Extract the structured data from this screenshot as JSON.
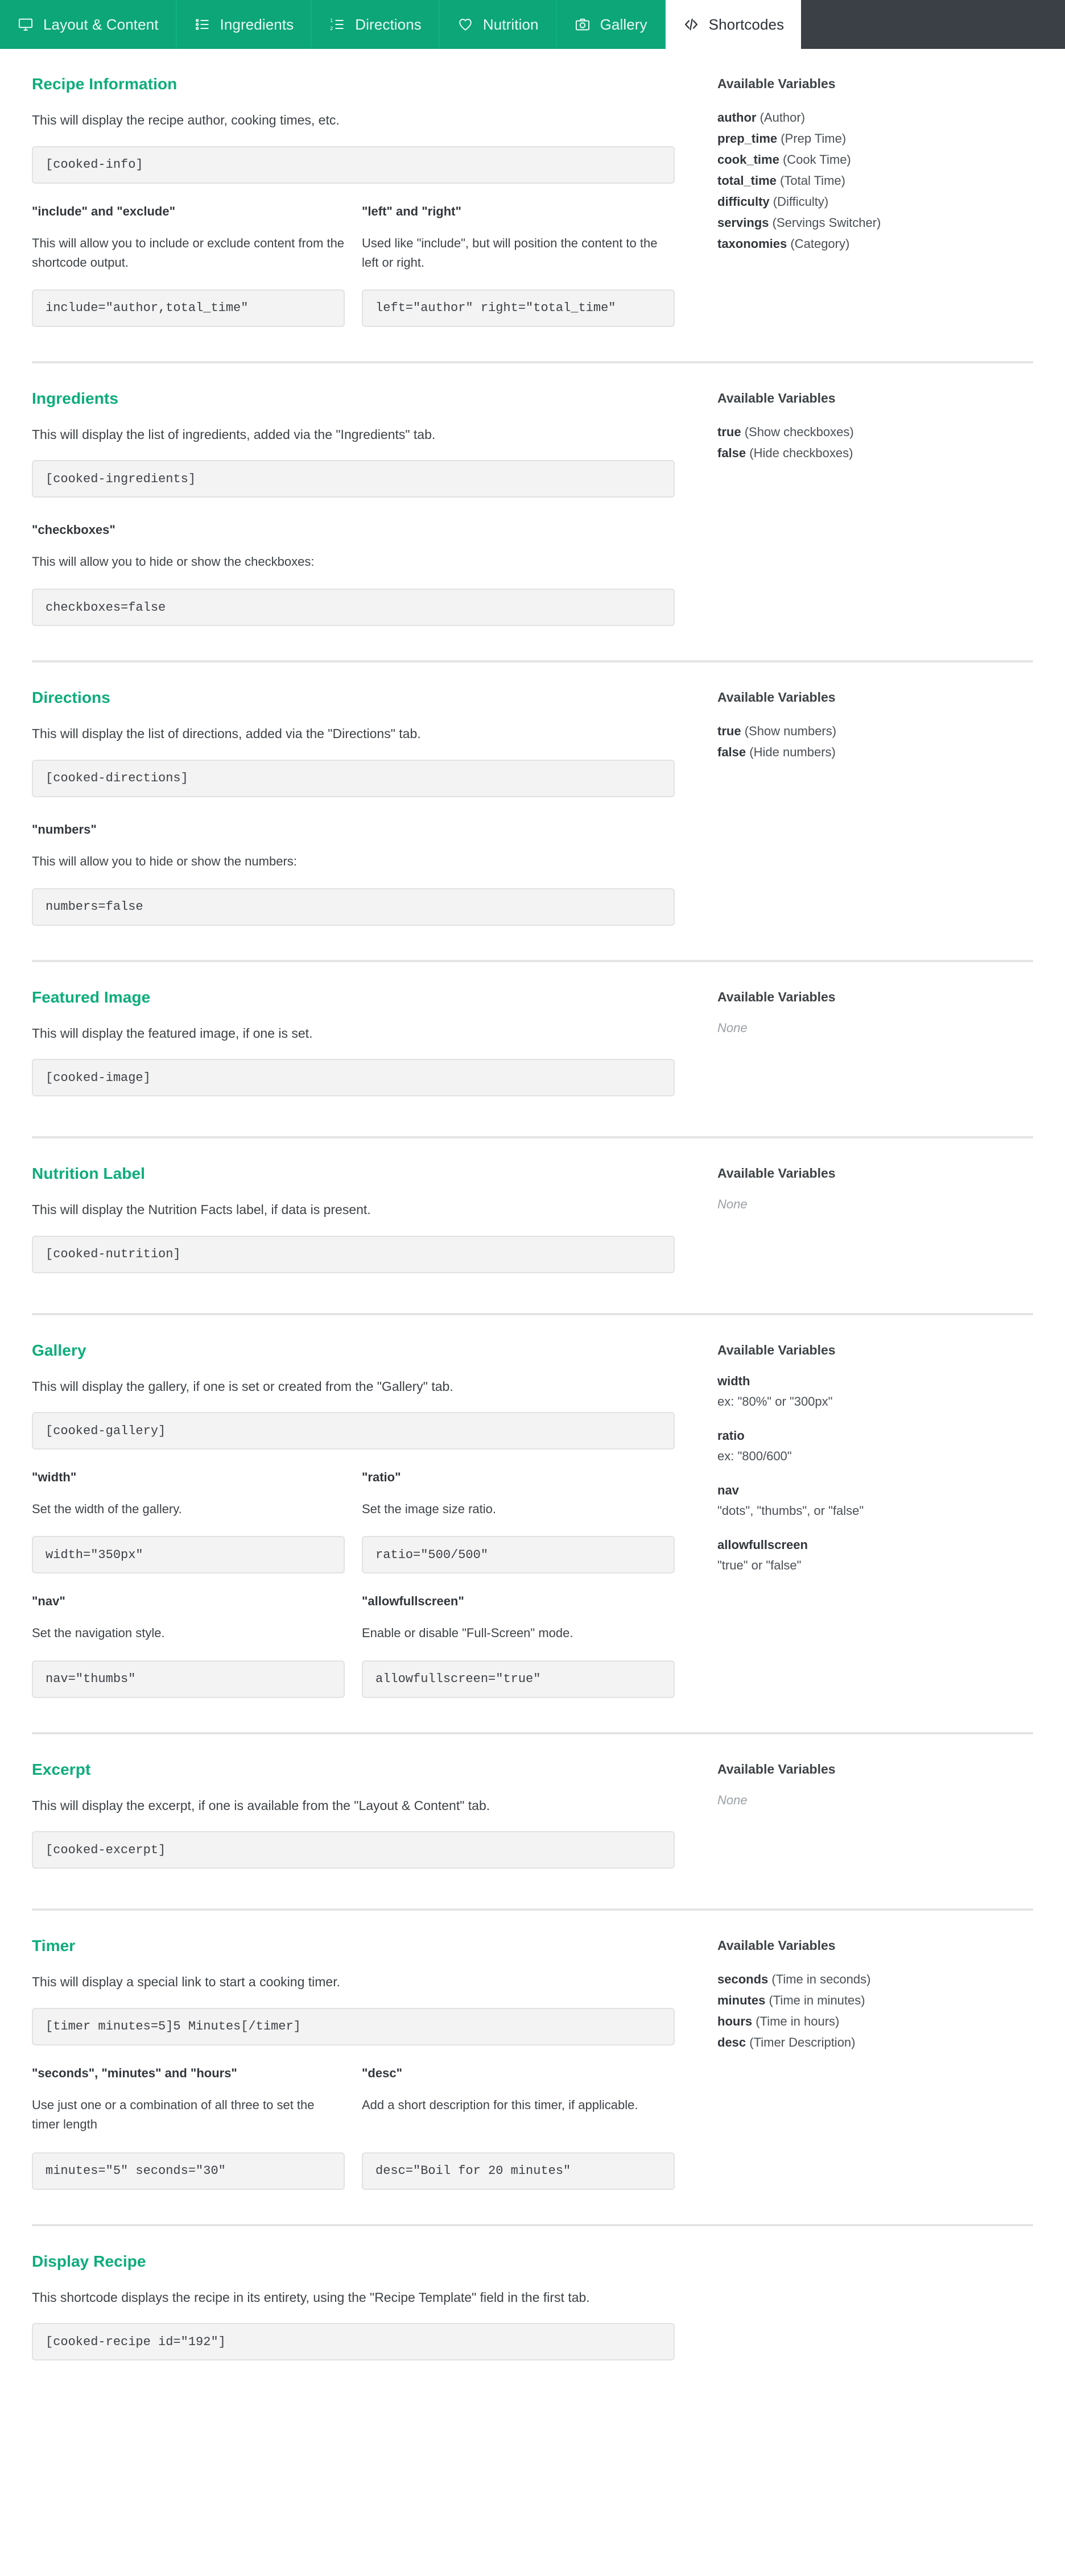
{
  "tabs": [
    {
      "label": "Layout & Content",
      "icon": "monitor-icon",
      "active": false
    },
    {
      "label": "Ingredients",
      "icon": "bullet-list-icon",
      "active": false
    },
    {
      "label": "Directions",
      "icon": "numbered-list-icon",
      "active": false
    },
    {
      "label": "Nutrition",
      "icon": "heart-icon",
      "active": false
    },
    {
      "label": "Gallery",
      "icon": "camera-icon",
      "active": false
    },
    {
      "label": "Shortcodes",
      "icon": "code-icon",
      "active": true
    }
  ],
  "colors": {
    "accent_green": "#0cad7a",
    "tab_green": "#0ca678",
    "tab_bar_dark": "#3a4045",
    "code_bg": "#f3f3f3",
    "code_border": "#e2e2e2",
    "divider": "#e4e4e4"
  },
  "variables_heading": "Available Variables",
  "none_label": "None",
  "sections": [
    {
      "id": "recipe-information",
      "title": "Recipe Information",
      "description": "This will display the recipe author, cooking times, etc.",
      "code": "[cooked-info]",
      "variables": [
        {
          "name": "author",
          "desc": "(Author)"
        },
        {
          "name": "prep_time",
          "desc": "(Prep Time)"
        },
        {
          "name": "cook_time",
          "desc": "(Cook Time)"
        },
        {
          "name": "total_time",
          "desc": "(Total Time)"
        },
        {
          "name": "difficulty",
          "desc": "(Difficulty)"
        },
        {
          "name": "servings",
          "desc": "(Servings Switcher)"
        },
        {
          "name": "taxonomies",
          "desc": "(Category)"
        }
      ],
      "subfields": [
        {
          "label": "\"include\" and \"exclude\"",
          "desc": "This will allow you to include or exclude content from the shortcode output.",
          "code": "include=\"author,total_time\""
        },
        {
          "label": "\"left\" and \"right\"",
          "desc": "Used like \"include\", but will position the content to the left or right.",
          "code": "left=\"author\" right=\"total_time\""
        }
      ]
    },
    {
      "id": "ingredients",
      "title": "Ingredients",
      "description": "This will display the list of ingredients, added via the \"Ingredients\" tab.",
      "code": "[cooked-ingredients]",
      "variables": [
        {
          "name": "true",
          "desc": "(Show checkboxes)"
        },
        {
          "name": "false",
          "desc": "(Hide checkboxes)"
        }
      ],
      "subfields": [
        {
          "label": "\"checkboxes\"",
          "desc": "This will allow you to hide or show the checkboxes:",
          "code": "checkboxes=false",
          "full_width": true
        }
      ]
    },
    {
      "id": "directions",
      "title": "Directions",
      "description": "This will display the list of directions, added via the \"Directions\" tab.",
      "code": "[cooked-directions]",
      "variables": [
        {
          "name": "true",
          "desc": "(Show numbers)"
        },
        {
          "name": "false",
          "desc": "(Hide numbers)"
        }
      ],
      "subfields": [
        {
          "label": "\"numbers\"",
          "desc": "This will allow you to hide or show the numbers:",
          "code": "numbers=false",
          "full_width": true
        }
      ]
    },
    {
      "id": "featured-image",
      "title": "Featured Image",
      "description": "This will display the featured image, if one is set.",
      "code": "[cooked-image]",
      "variables": [],
      "subfields": []
    },
    {
      "id": "nutrition-label",
      "title": "Nutrition Label",
      "description": "This will display the Nutrition Facts label, if data is present.",
      "code": "[cooked-nutrition]",
      "variables": [],
      "subfields": []
    },
    {
      "id": "gallery",
      "title": "Gallery",
      "description": "This will display the gallery, if one is set or created from the \"Gallery\" tab.",
      "code": "[cooked-gallery]",
      "variable_groups": [
        {
          "name": "width",
          "example": "ex: \"80%\" or \"300px\""
        },
        {
          "name": "ratio",
          "example": "ex: \"800/600\""
        },
        {
          "name": "nav",
          "example": "\"dots\", \"thumbs\", or \"false\""
        },
        {
          "name": "allowfullscreen",
          "example": "\"true\" or \"false\""
        }
      ],
      "variables": [],
      "subfields": [
        {
          "label": "\"width\"",
          "desc": "Set the width of the gallery.",
          "code": "width=\"350px\""
        },
        {
          "label": "\"ratio\"",
          "desc": "Set the image size ratio.",
          "code": "ratio=\"500/500\""
        },
        {
          "label": "\"nav\"",
          "desc": "Set the navigation style.",
          "code": "nav=\"thumbs\""
        },
        {
          "label": "\"allowfullscreen\"",
          "desc": "Enable or disable \"Full-Screen\" mode.",
          "code": "allowfullscreen=\"true\""
        }
      ]
    },
    {
      "id": "excerpt",
      "title": "Excerpt",
      "description": "This will display the excerpt, if one is available from the \"Layout & Content\" tab.",
      "code": "[cooked-excerpt]",
      "variables": [],
      "subfields": []
    },
    {
      "id": "timer",
      "title": "Timer",
      "description": "This will display a special link to start a cooking timer.",
      "code": "[timer minutes=5]5 Minutes[/timer]",
      "variables": [
        {
          "name": "seconds",
          "desc": "(Time in seconds)"
        },
        {
          "name": "minutes",
          "desc": "(Time in minutes)"
        },
        {
          "name": "hours",
          "desc": "(Time in hours)"
        },
        {
          "name": "desc",
          "desc": "(Timer Description)"
        }
      ],
      "subfields": [
        {
          "label": "\"seconds\", \"minutes\" and \"hours\"",
          "desc": "Use just one or a combination of all three to set the timer length",
          "code": "minutes=\"5\" seconds=\"30\"",
          "two_line": true
        },
        {
          "label": "\"desc\"",
          "desc": "Add a short description for this timer, if applicable.",
          "code": "desc=\"Boil for 20 minutes\"",
          "two_line": true
        }
      ]
    },
    {
      "id": "display-recipe",
      "title": "Display Recipe",
      "description": "This shortcode displays the recipe in its entirety, using the \"Recipe Template\" field in the first tab.",
      "code": "[cooked-recipe id=\"192\"]",
      "variables": [],
      "subfields": [],
      "no_variables_column": true
    }
  ]
}
